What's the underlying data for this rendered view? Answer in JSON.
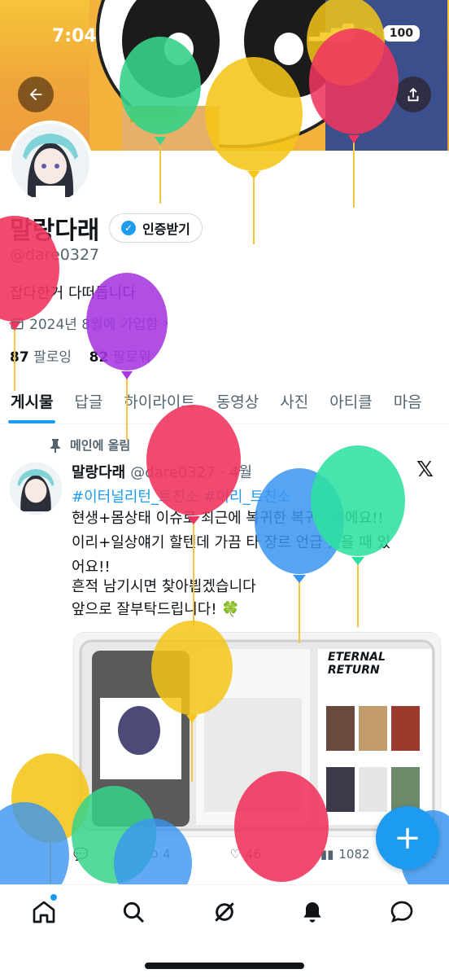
{
  "status": {
    "time": "7:04",
    "battery": "100"
  },
  "profile": {
    "name": "말랑다래",
    "verify_label": "인증받기",
    "handle": "@dare0327",
    "bio": "잡다한거 다떠듭니다",
    "joined": "2024년 8월에 가입함",
    "following_count": "87",
    "following_label": "팔로잉",
    "followers_count": "82",
    "followers_label": "팔로워"
  },
  "tabs": [
    "게시물",
    "답글",
    "하이라이트",
    "동영상",
    "사진",
    "아티클",
    "마음"
  ],
  "tweet": {
    "pinned_label": "메인에 올림",
    "author": "말랑다래",
    "handle": "@dare0327",
    "time": "· 4월",
    "hashtags": "#이터널리턴_트친소 #이리_트친소",
    "lines": [
      "현생+몸상태 이슈로 최근에 복귀한 복귀뉴비에요!!",
      "이리+일상얘기 할텐데 가끔 타 장르 언급 있을 때 있",
      "어요!!",
      "흔적 남기시면 찾아뵙겠습니다",
      "앞으로 잘부탁드립니다! 🍀"
    ],
    "media_title": "ETERNAL RETURN",
    "actions": {
      "retweets": "4",
      "likes": "46",
      "views": "1082"
    }
  },
  "icons": {
    "back": "arrow-left-icon",
    "share": "share-icon",
    "calendar": "calendar-icon",
    "pin": "pin-icon",
    "x_logo": "x-logo-icon",
    "compose": "plus-icon"
  },
  "colors": {
    "accent": "#1d9bf0",
    "text": "#0f1419",
    "muted": "#536471"
  }
}
